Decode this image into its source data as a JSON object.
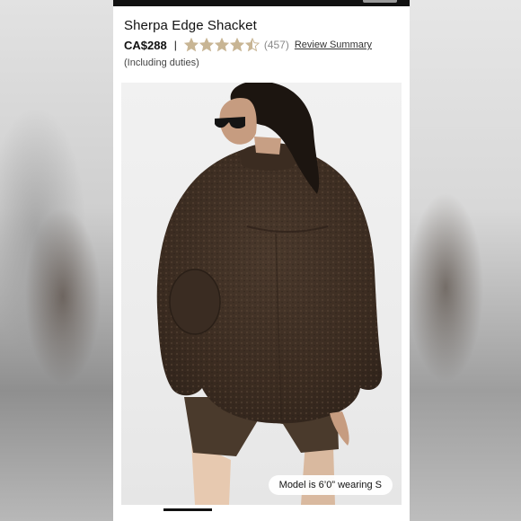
{
  "product": {
    "title": "Sherpa Edge Shacket",
    "price": "CA$288",
    "separator": "|",
    "rating": {
      "value": 4.5,
      "max": 5,
      "count_label": "(457)",
      "star_color": "#c8b594",
      "star_empty_color": "#c8b594"
    },
    "review_link": "Review Summary",
    "duties_note": "(Including duties)"
  },
  "gallery": {
    "model_badge": "Model is 6’0” wearing S"
  },
  "icons": {
    "star": "star-icon",
    "star_half": "star-half-icon"
  },
  "colors": {
    "jacket": "#3e2f24",
    "shorts": "#4a3a2c",
    "background": "#ffffff"
  }
}
